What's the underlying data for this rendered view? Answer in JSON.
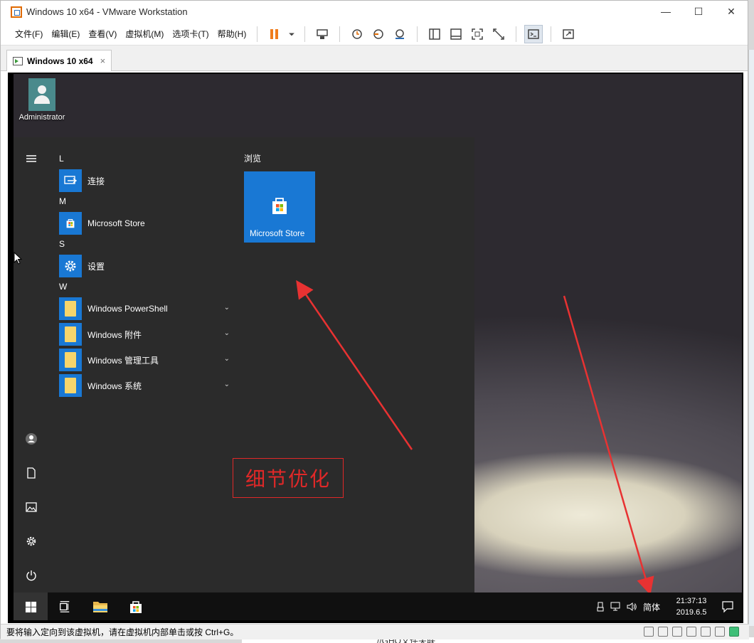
{
  "window": {
    "title": "Windows 10 x64 - VMware Workstation",
    "controls": [
      "minimize",
      "maximize",
      "close"
    ]
  },
  "menu": [
    "文件(F)",
    "编辑(E)",
    "查看(V)",
    "虚拟机(M)",
    "选项卡(T)",
    "帮助(H)"
  ],
  "toolbar_icons": [
    "pause-icon",
    "dropdown-icon",
    "send-ctrl-alt-del-icon",
    "snapshot-icon",
    "revert-snapshot-icon",
    "snapshot-manager-icon",
    "sidebar-icon",
    "thumbnail-bar-icon",
    "fullscreen-icon",
    "unity-icon",
    "console-icon",
    "stretch-icon"
  ],
  "tab": {
    "label": "Windows 10 x64",
    "close": "×"
  },
  "desktop": {
    "icon_label": "Administrator"
  },
  "start_menu": {
    "groups": [
      {
        "letter": "L",
        "apps": [
          {
            "name": "连接",
            "icon": "connect-icon",
            "expandable": false
          }
        ]
      },
      {
        "letter": "M",
        "apps": [
          {
            "name": "Microsoft Store",
            "icon": "store-icon",
            "expandable": false
          }
        ]
      },
      {
        "letter": "S",
        "apps": [
          {
            "name": "设置",
            "icon": "gear-icon",
            "expandable": false
          }
        ]
      },
      {
        "letter": "W",
        "apps": [
          {
            "name": "Windows PowerShell",
            "icon": "folder-icon",
            "expandable": true
          },
          {
            "name": "Windows 附件",
            "icon": "folder-icon",
            "expandable": true
          },
          {
            "name": "Windows 管理工具",
            "icon": "folder-icon",
            "expandable": true
          },
          {
            "name": "Windows 系统",
            "icon": "folder-icon",
            "expandable": true
          }
        ]
      }
    ],
    "tiles_header": "浏览",
    "tile_label": "Microsoft Store"
  },
  "annotation": {
    "text": "细节优化",
    "color": "#e02828"
  },
  "taskbar": {
    "ime": "简体",
    "time": "21:37:13",
    "date": "2019.6.5"
  },
  "status_bar": {
    "text": "要将输入定向到该虚拟机，请在虚拟机内部单击或按 Ctrl+G。"
  },
  "background_text": "//GHO文件关联",
  "colors": {
    "accent": "#1978d4",
    "start_bg": "#2b2b2b",
    "taskbar_bg": "#101010",
    "pause": "#f07c1b"
  }
}
